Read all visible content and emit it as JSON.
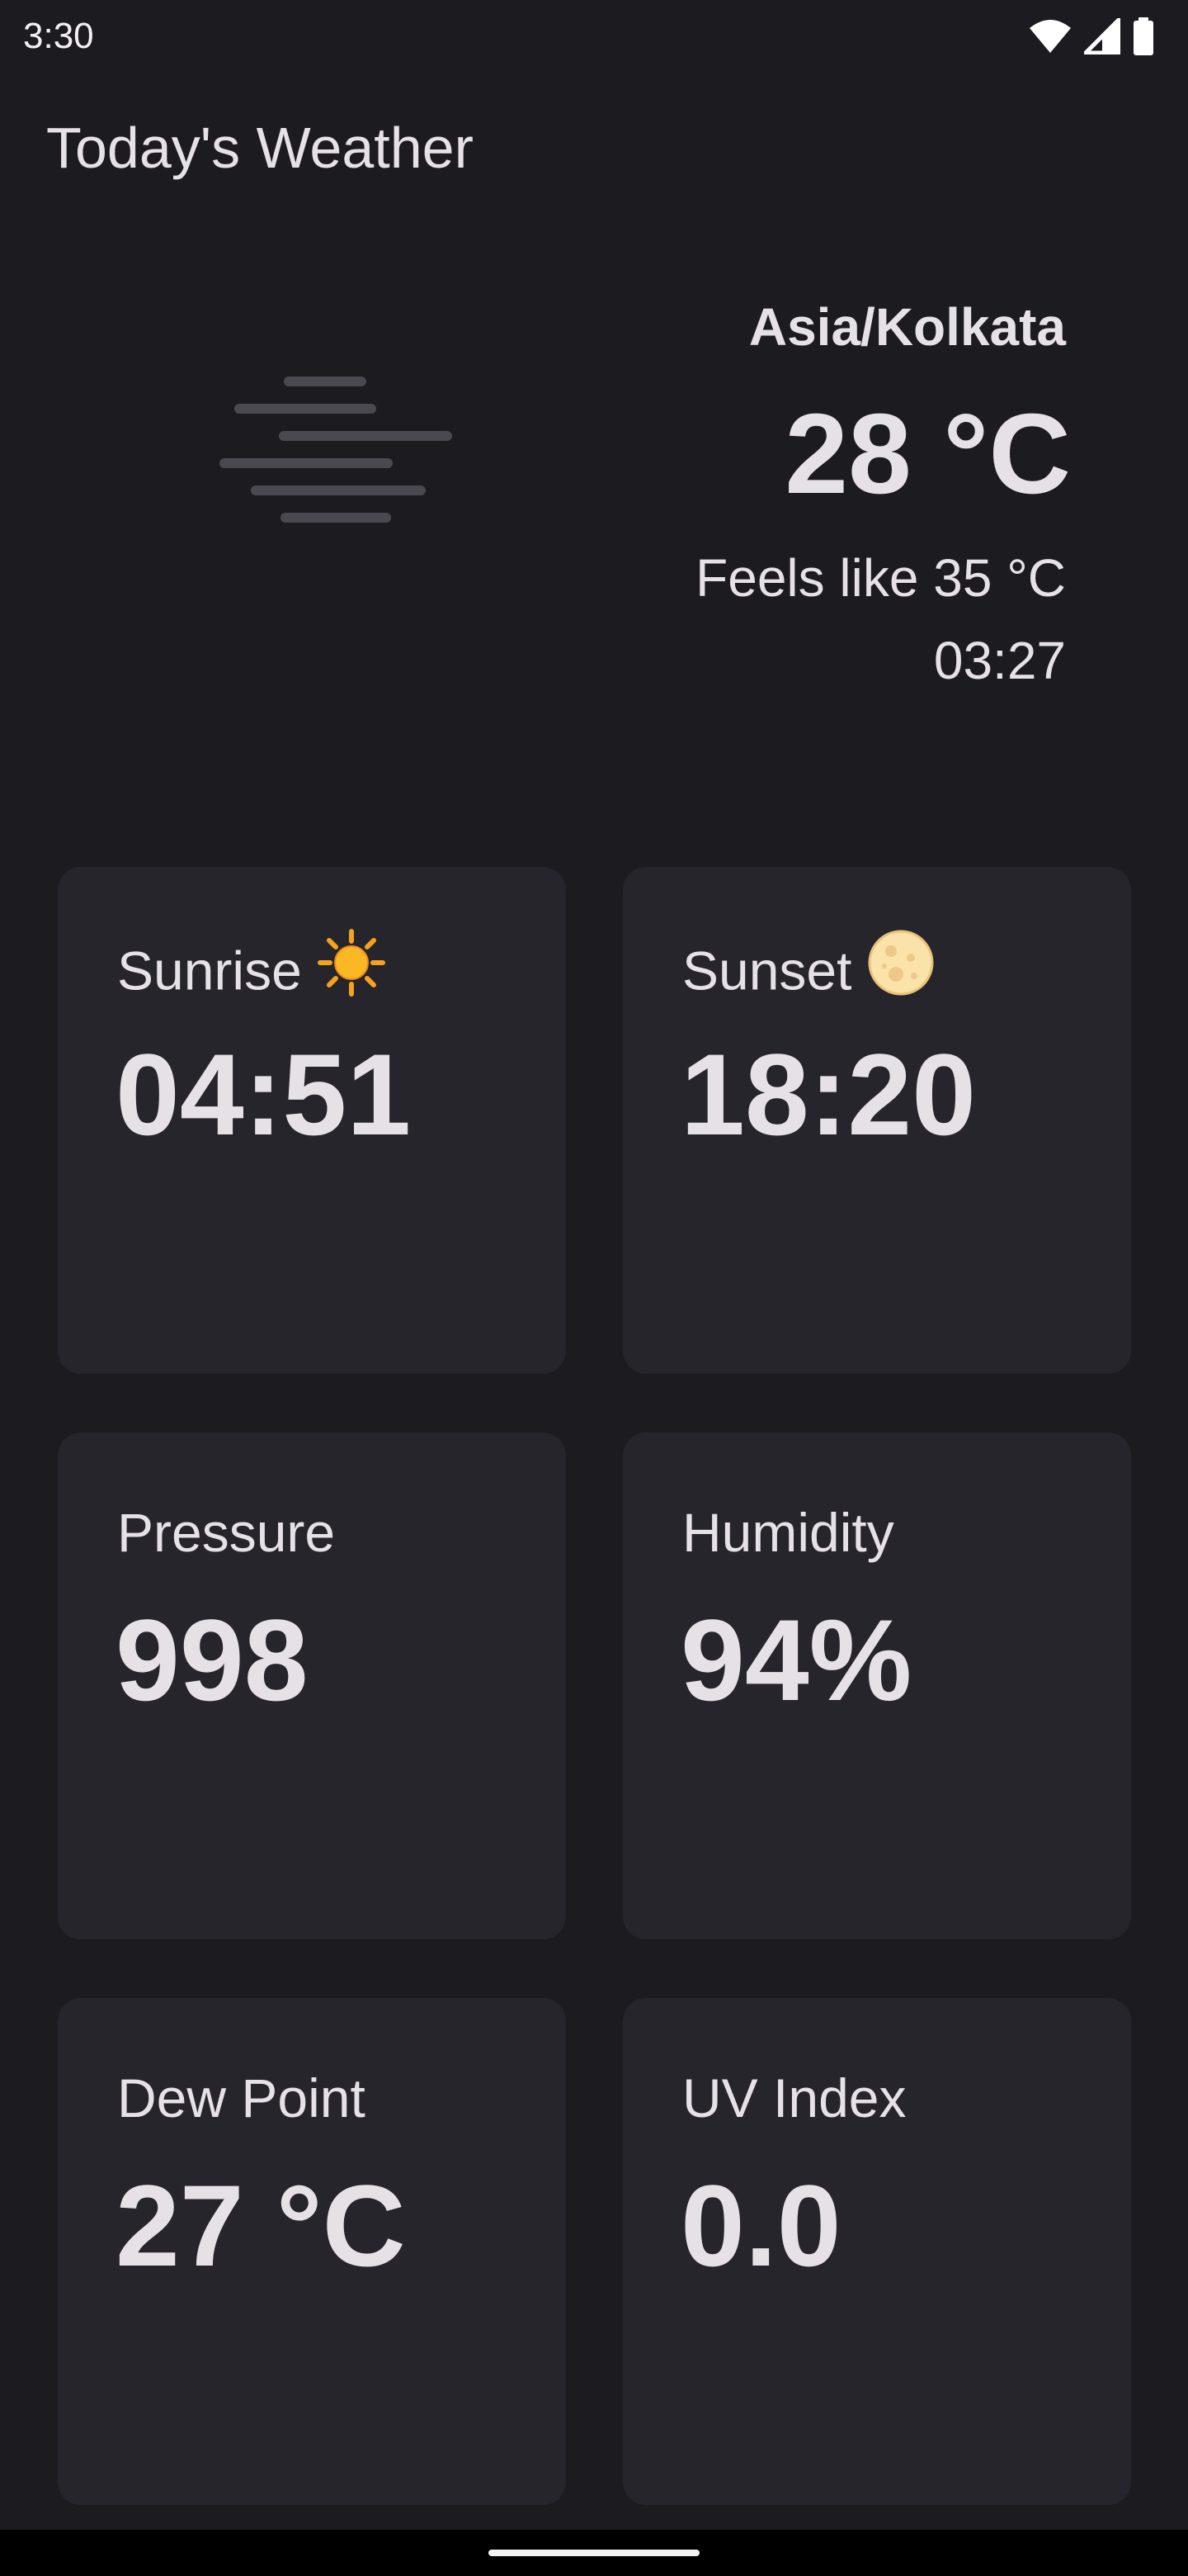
{
  "status_bar": {
    "time": "3:30",
    "icons": [
      "wifi-icon",
      "cellular-signal-icon",
      "battery-icon"
    ]
  },
  "app": {
    "title": "Today's Weather"
  },
  "current": {
    "condition_icon": "fog-icon",
    "location": "Asia/Kolkata",
    "temperature": "28 °C",
    "feels_like": "Feels like 35 °C",
    "time": "03:27"
  },
  "cards": {
    "sunrise": {
      "label": "Sunrise",
      "icon": "sun-icon",
      "value": "04:51"
    },
    "sunset": {
      "label": "Sunset",
      "icon": "full-moon-icon",
      "value": "18:20"
    },
    "pressure": {
      "label": "Pressure",
      "value": "998"
    },
    "humidity": {
      "label": "Humidity",
      "value": "94%"
    },
    "dew_point": {
      "label": "Dew Point",
      "value": "27 °C"
    },
    "uv_index": {
      "label": "UV Index",
      "value": "0.0"
    }
  },
  "colors": {
    "background": "#1c1b20",
    "card": "#26252b",
    "text": "#e6e1e6",
    "fog_lines": "#4a4950"
  }
}
